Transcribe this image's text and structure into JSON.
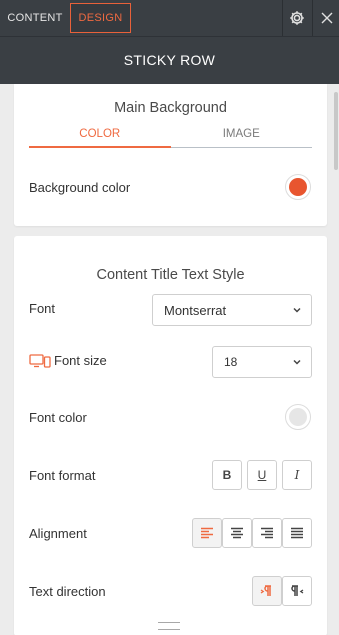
{
  "tabs": {
    "content": "CONTENT",
    "design": "DESIGN"
  },
  "panel": {
    "title": "STICKY ROW"
  },
  "main_background": {
    "title": "Main Background",
    "tabs": [
      "COLOR",
      "IMAGE"
    ],
    "background_color": {
      "label": "Background color",
      "value": "#e8552f"
    }
  },
  "content_title": {
    "title": "Content Title Text Style",
    "font": {
      "label": "Font",
      "value": "Montserrat"
    },
    "font_size": {
      "label": "Font size",
      "value": "18"
    },
    "font_color": {
      "label": "Font color",
      "value": "#e6e6e6"
    },
    "font_format": {
      "label": "Font format",
      "buttons": [
        "B",
        "U",
        "I"
      ]
    },
    "alignment": {
      "label": "Alignment",
      "buttons": [
        "align-left-icon",
        "align-center-icon",
        "align-right-icon",
        "align-justify-icon"
      ]
    },
    "text_direction": {
      "label": "Text direction",
      "buttons": [
        "ltr-icon",
        "rtl-icon"
      ]
    }
  },
  "colors": {
    "accent": "#ef6a41",
    "header_bg": "#3a3f44"
  }
}
